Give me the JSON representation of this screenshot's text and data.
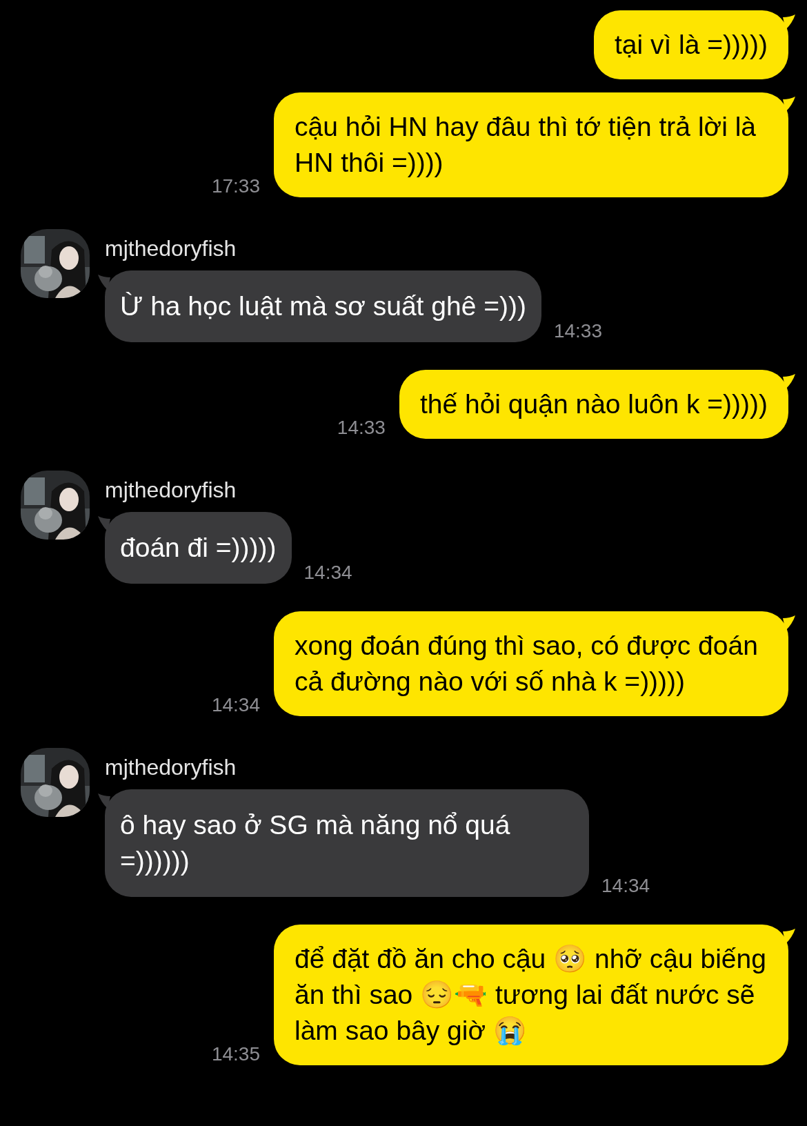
{
  "messages": [
    {
      "kind": "sent",
      "text": "tại vì là =)))))"
    },
    {
      "kind": "sent",
      "text": "cậu hỏi HN hay đâu thì tớ tiện trả lời là HN thôi =))))",
      "time": "17:33"
    },
    {
      "kind": "received",
      "sender": "mjthedoryfish",
      "text": "Ừ ha học luật mà sơ suất ghê =)))",
      "time": "14:33"
    },
    {
      "kind": "sent",
      "text": "thế hỏi quận nào luôn k =)))))",
      "time": "14:33"
    },
    {
      "kind": "received",
      "sender": "mjthedoryfish",
      "text": "đoán đi =)))))",
      "time": "14:34"
    },
    {
      "kind": "sent",
      "text": "xong đoán đúng thì sao, có được đoán cả đường nào với số nhà k =)))))",
      "time": "14:34"
    },
    {
      "kind": "received",
      "sender": "mjthedoryfish",
      "text": "ô hay sao ở SG mà năng nổ quá =))))))",
      "time": "14:34"
    },
    {
      "kind": "sent",
      "text": "để đặt đồ ăn cho cậu 🥺 nhỡ cậu biếng ăn thì sao 😔🔫 tương lai đất nước sẽ làm sao bây giờ 😭",
      "time": "14:35"
    }
  ]
}
